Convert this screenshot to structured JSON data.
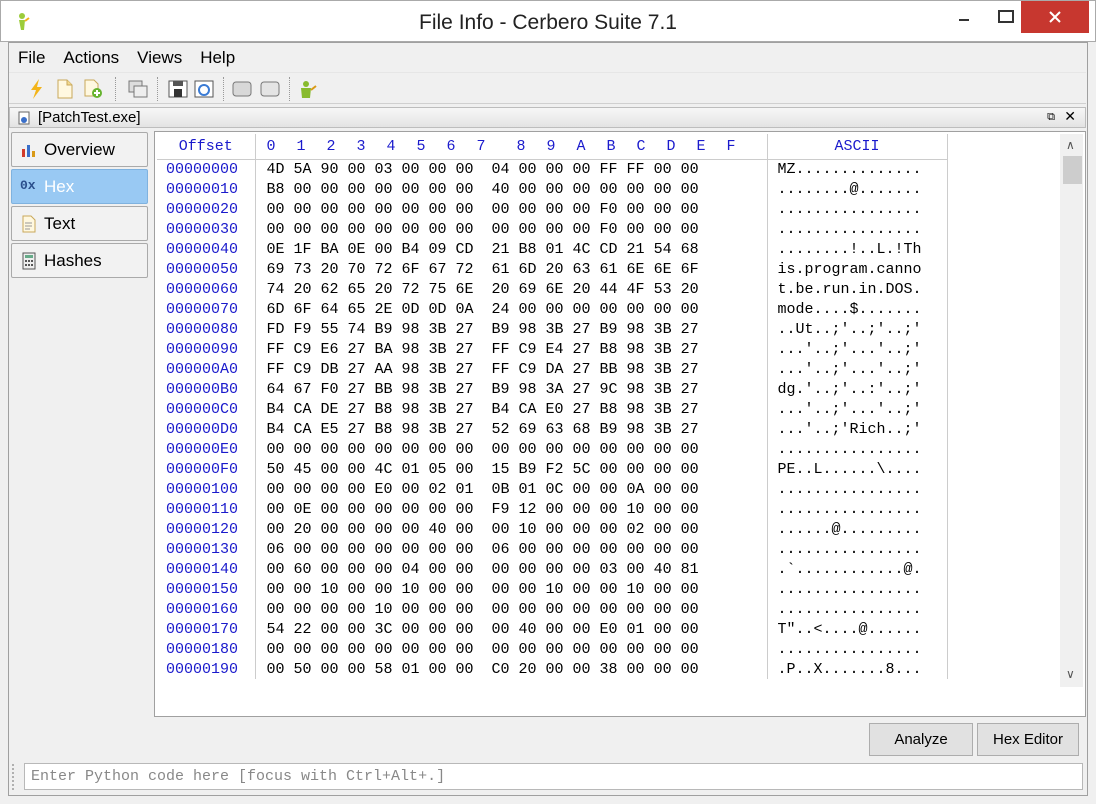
{
  "window": {
    "title": "File Info - Cerbero Suite 7.1"
  },
  "menu": [
    "File",
    "Actions",
    "Views",
    "Help"
  ],
  "document": {
    "tab_title": "[PatchTest.exe]"
  },
  "side_tabs": [
    {
      "label": "Overview",
      "icon": "bar-chart-icon"
    },
    {
      "label": "Hex",
      "icon": "hex-icon",
      "icon_text": "0x",
      "active": true
    },
    {
      "label": "Text",
      "icon": "text-file-icon"
    },
    {
      "label": "Hashes",
      "icon": "calculator-icon"
    }
  ],
  "hex": {
    "header_offset": "Offset",
    "header_cols": [
      "0",
      "1",
      "2",
      "3",
      "4",
      "5",
      "6",
      "7",
      "8",
      "9",
      "A",
      "B",
      "C",
      "D",
      "E",
      "F"
    ],
    "header_ascii": "ASCII",
    "rows": [
      {
        "offset": "00000000",
        "hex": "4D 5A 90 00 03 00 00 00  04 00 00 00 FF FF 00 00",
        "ascii": "MZ.............."
      },
      {
        "offset": "00000010",
        "hex": "B8 00 00 00 00 00 00 00  40 00 00 00 00 00 00 00",
        "ascii": "........@......."
      },
      {
        "offset": "00000020",
        "hex": "00 00 00 00 00 00 00 00  00 00 00 00 F0 00 00 00",
        "ascii": "................"
      },
      {
        "offset": "00000030",
        "hex": "00 00 00 00 00 00 00 00  00 00 00 00 F0 00 00 00",
        "ascii": "................"
      },
      {
        "offset": "00000040",
        "hex": "0E 1F BA 0E 00 B4 09 CD  21 B8 01 4C CD 21 54 68",
        "ascii": "........!..L.!Th"
      },
      {
        "offset": "00000050",
        "hex": "69 73 20 70 72 6F 67 72  61 6D 20 63 61 6E 6E 6F",
        "ascii": "is.program.canno"
      },
      {
        "offset": "00000060",
        "hex": "74 20 62 65 20 72 75 6E  20 69 6E 20 44 4F 53 20",
        "ascii": "t.be.run.in.DOS."
      },
      {
        "offset": "00000070",
        "hex": "6D 6F 64 65 2E 0D 0D 0A  24 00 00 00 00 00 00 00",
        "ascii": "mode....$......."
      },
      {
        "offset": "00000080",
        "hex": "FD F9 55 74 B9 98 3B 27  B9 98 3B 27 B9 98 3B 27",
        "ascii": "..Ut..;'..;'..;'"
      },
      {
        "offset": "00000090",
        "hex": "FF C9 E6 27 BA 98 3B 27  FF C9 E4 27 B8 98 3B 27",
        "ascii": "...'..;'...'..;'"
      },
      {
        "offset": "000000A0",
        "hex": "FF C9 DB 27 AA 98 3B 27  FF C9 DA 27 BB 98 3B 27",
        "ascii": "...'..;'...'..;'"
      },
      {
        "offset": "000000B0",
        "hex": "64 67 F0 27 BB 98 3B 27  B9 98 3A 27 9C 98 3B 27",
        "ascii": "dg.'..;'..:'..;'"
      },
      {
        "offset": "000000C0",
        "hex": "B4 CA DE 27 B8 98 3B 27  B4 CA E0 27 B8 98 3B 27",
        "ascii": "...'..;'...'..;'"
      },
      {
        "offset": "000000D0",
        "hex": "B4 CA E5 27 B8 98 3B 27  52 69 63 68 B9 98 3B 27",
        "ascii": "...'..;'Rich..;'"
      },
      {
        "offset": "000000E0",
        "hex": "00 00 00 00 00 00 00 00  00 00 00 00 00 00 00 00",
        "ascii": "................"
      },
      {
        "offset": "000000F0",
        "hex": "50 45 00 00 4C 01 05 00  15 B9 F2 5C 00 00 00 00",
        "ascii": "PE..L......\\...."
      },
      {
        "offset": "00000100",
        "hex": "00 00 00 00 E0 00 02 01  0B 01 0C 00 00 0A 00 00",
        "ascii": "................"
      },
      {
        "offset": "00000110",
        "hex": "00 0E 00 00 00 00 00 00  F9 12 00 00 00 10 00 00",
        "ascii": "................"
      },
      {
        "offset": "00000120",
        "hex": "00 20 00 00 00 00 40 00  00 10 00 00 00 02 00 00",
        "ascii": "......@........."
      },
      {
        "offset": "00000130",
        "hex": "06 00 00 00 00 00 00 00  06 00 00 00 00 00 00 00",
        "ascii": "................"
      },
      {
        "offset": "00000140",
        "hex": "00 60 00 00 00 04 00 00  00 00 00 00 03 00 40 81",
        "ascii": ".`............@."
      },
      {
        "offset": "00000150",
        "hex": "00 00 10 00 00 10 00 00  00 00 10 00 00 10 00 00",
        "ascii": "................"
      },
      {
        "offset": "00000160",
        "hex": "00 00 00 00 10 00 00 00  00 00 00 00 00 00 00 00",
        "ascii": "................"
      },
      {
        "offset": "00000170",
        "hex": "54 22 00 00 3C 00 00 00  00 40 00 00 E0 01 00 00",
        "ascii": "T\"..<....@......"
      },
      {
        "offset": "00000180",
        "hex": "00 00 00 00 00 00 00 00  00 00 00 00 00 00 00 00",
        "ascii": "................"
      },
      {
        "offset": "00000190",
        "hex": "00 50 00 00 58 01 00 00  C0 20 00 00 38 00 00 00",
        "ascii": ".P..X.......8..."
      }
    ]
  },
  "buttons": {
    "analyze": "Analyze",
    "hex_editor": "Hex Editor"
  },
  "python": {
    "placeholder": "Enter Python code here [focus with Ctrl+Alt+.]"
  },
  "colors": {
    "offset_blue": "#1a1acc",
    "active_tab": "#99c9f3",
    "close_red": "#c7372f"
  }
}
